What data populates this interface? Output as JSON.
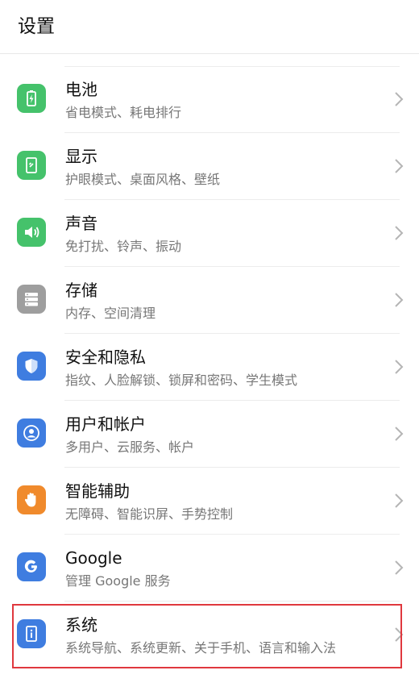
{
  "header": {
    "title": "设置"
  },
  "colors": {
    "green": "#45c26b",
    "gray": "#9e9e9e",
    "blue": "#3f7de0",
    "orange": "#f08a2c",
    "highlight": "#e0383e"
  },
  "items": [
    {
      "id": "battery",
      "title": "电池",
      "subtitle": "省电模式、耗电排行",
      "icon": "battery-icon",
      "icon_color": "#45c26b"
    },
    {
      "id": "display",
      "title": "显示",
      "subtitle": "护眼模式、桌面风格、壁纸",
      "icon": "display-icon",
      "icon_color": "#45c26b"
    },
    {
      "id": "sound",
      "title": "声音",
      "subtitle": "免打扰、铃声、振动",
      "icon": "speaker-icon",
      "icon_color": "#45c26b"
    },
    {
      "id": "storage",
      "title": "存储",
      "subtitle": "内存、空间清理",
      "icon": "storage-icon",
      "icon_color": "#9e9e9e"
    },
    {
      "id": "security",
      "title": "安全和隐私",
      "subtitle": "指纹、人脸解锁、锁屏和密码、学生模式",
      "icon": "shield-icon",
      "icon_color": "#3f7de0"
    },
    {
      "id": "accounts",
      "title": "用户和帐户",
      "subtitle": "多用户、云服务、帐户",
      "icon": "user-icon",
      "icon_color": "#3f7de0"
    },
    {
      "id": "assist",
      "title": "智能辅助",
      "subtitle": "无障碍、智能识屏、手势控制",
      "icon": "hand-icon",
      "icon_color": "#f08a2c"
    },
    {
      "id": "google",
      "title": "Google",
      "subtitle": "管理 Google 服务",
      "icon": "google-icon",
      "icon_color": "#3f7de0"
    },
    {
      "id": "system",
      "title": "系统",
      "subtitle": "系统导航、系统更新、关于手机、语言和输入法",
      "icon": "system-info-icon",
      "icon_color": "#3f7de0"
    }
  ]
}
